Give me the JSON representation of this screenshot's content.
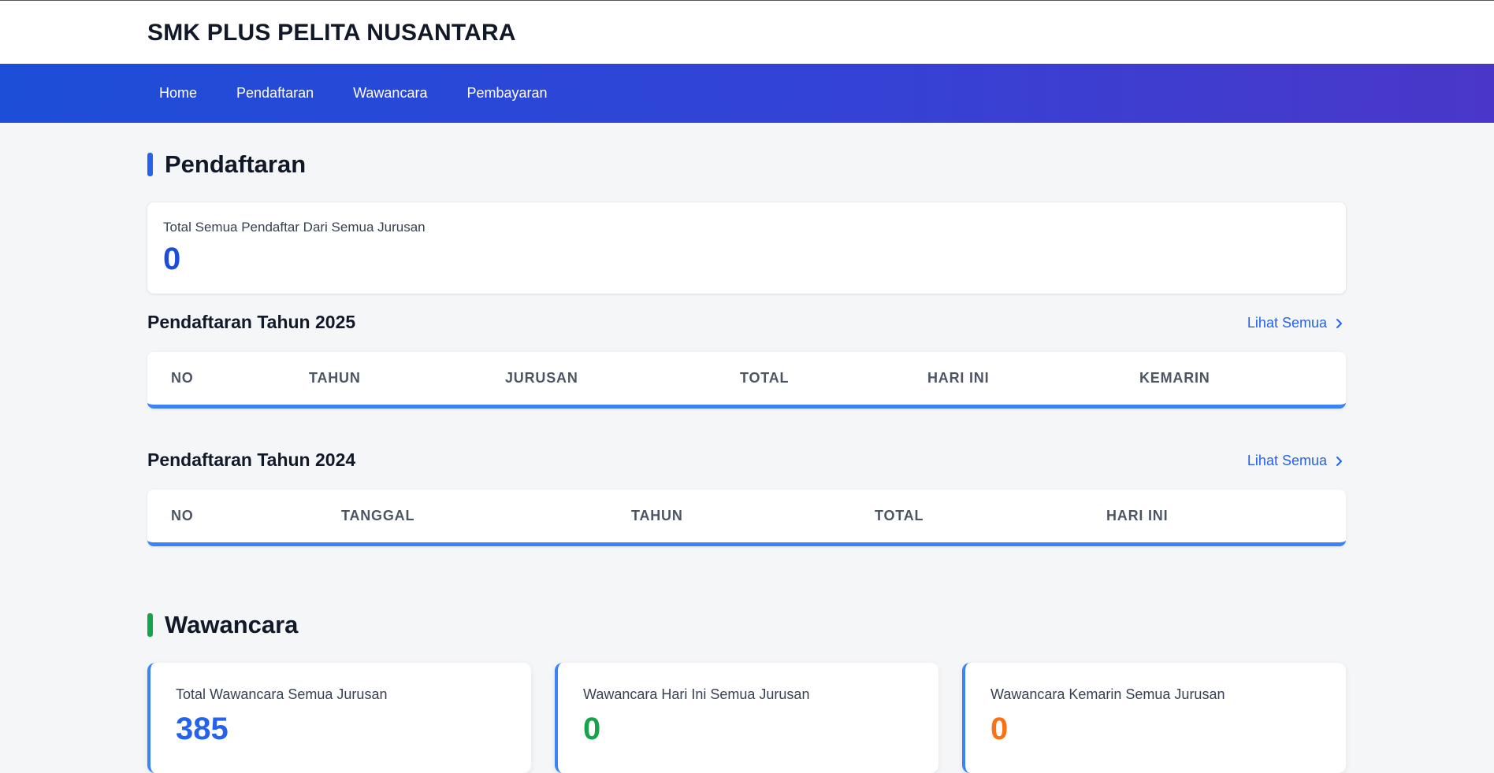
{
  "brand": "SMK PLUS PELITA NUSANTARA",
  "nav": [
    "Home",
    "Pendaftaran",
    "Wawancara",
    "Pembayaran"
  ],
  "pendaftaran": {
    "title": "Pendaftaran",
    "total_label": "Total Semua Pendaftar Dari Semua Jurusan",
    "total_value": "0",
    "table2025": {
      "heading": "Pendaftaran Tahun 2025",
      "see_all": "Lihat Semua",
      "columns": [
        "NO",
        "TAHUN",
        "JURUSAN",
        "TOTAL",
        "HARI INI",
        "KEMARIN"
      ]
    },
    "table2024": {
      "heading": "Pendaftaran Tahun 2024",
      "see_all": "Lihat Semua",
      "columns": [
        "NO",
        "TANGGAL",
        "TAHUN",
        "TOTAL",
        "HARI INI"
      ]
    }
  },
  "wawancara": {
    "title": "Wawancara",
    "cards": [
      {
        "label": "Total Wawancara Semua Jurusan",
        "value": "385",
        "color": "#2563eb"
      },
      {
        "label": "Wawancara Hari Ini Semua Jurusan",
        "value": "0",
        "color": "#16a34a"
      },
      {
        "label": "Wawancara Kemarin Semua Jurusan",
        "value": "0",
        "color": "#f97316"
      }
    ]
  },
  "colors": {
    "accent_blue": "#2563eb",
    "accent_green": "#16a34a",
    "accent_orange": "#f97316"
  }
}
